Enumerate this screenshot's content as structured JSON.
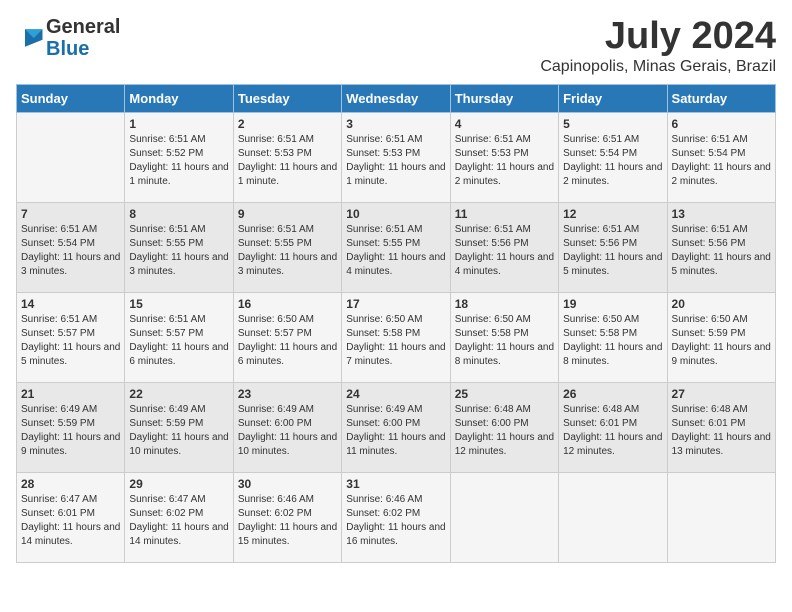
{
  "logo": {
    "line1": "General",
    "line2": "Blue"
  },
  "title": "July 2024",
  "location": "Capinopolis, Minas Gerais, Brazil",
  "days_header": [
    "Sunday",
    "Monday",
    "Tuesday",
    "Wednesday",
    "Thursday",
    "Friday",
    "Saturday"
  ],
  "weeks": [
    [
      {
        "day": "",
        "sunrise": "",
        "sunset": "",
        "daylight": ""
      },
      {
        "day": "1",
        "sunrise": "Sunrise: 6:51 AM",
        "sunset": "Sunset: 5:52 PM",
        "daylight": "Daylight: 11 hours and 1 minute."
      },
      {
        "day": "2",
        "sunrise": "Sunrise: 6:51 AM",
        "sunset": "Sunset: 5:53 PM",
        "daylight": "Daylight: 11 hours and 1 minute."
      },
      {
        "day": "3",
        "sunrise": "Sunrise: 6:51 AM",
        "sunset": "Sunset: 5:53 PM",
        "daylight": "Daylight: 11 hours and 1 minute."
      },
      {
        "day": "4",
        "sunrise": "Sunrise: 6:51 AM",
        "sunset": "Sunset: 5:53 PM",
        "daylight": "Daylight: 11 hours and 2 minutes."
      },
      {
        "day": "5",
        "sunrise": "Sunrise: 6:51 AM",
        "sunset": "Sunset: 5:54 PM",
        "daylight": "Daylight: 11 hours and 2 minutes."
      },
      {
        "day": "6",
        "sunrise": "Sunrise: 6:51 AM",
        "sunset": "Sunset: 5:54 PM",
        "daylight": "Daylight: 11 hours and 2 minutes."
      }
    ],
    [
      {
        "day": "7",
        "sunrise": "Sunrise: 6:51 AM",
        "sunset": "Sunset: 5:54 PM",
        "daylight": "Daylight: 11 hours and 3 minutes."
      },
      {
        "day": "8",
        "sunrise": "Sunrise: 6:51 AM",
        "sunset": "Sunset: 5:55 PM",
        "daylight": "Daylight: 11 hours and 3 minutes."
      },
      {
        "day": "9",
        "sunrise": "Sunrise: 6:51 AM",
        "sunset": "Sunset: 5:55 PM",
        "daylight": "Daylight: 11 hours and 3 minutes."
      },
      {
        "day": "10",
        "sunrise": "Sunrise: 6:51 AM",
        "sunset": "Sunset: 5:55 PM",
        "daylight": "Daylight: 11 hours and 4 minutes."
      },
      {
        "day": "11",
        "sunrise": "Sunrise: 6:51 AM",
        "sunset": "Sunset: 5:56 PM",
        "daylight": "Daylight: 11 hours and 4 minutes."
      },
      {
        "day": "12",
        "sunrise": "Sunrise: 6:51 AM",
        "sunset": "Sunset: 5:56 PM",
        "daylight": "Daylight: 11 hours and 5 minutes."
      },
      {
        "day": "13",
        "sunrise": "Sunrise: 6:51 AM",
        "sunset": "Sunset: 5:56 PM",
        "daylight": "Daylight: 11 hours and 5 minutes."
      }
    ],
    [
      {
        "day": "14",
        "sunrise": "Sunrise: 6:51 AM",
        "sunset": "Sunset: 5:57 PM",
        "daylight": "Daylight: 11 hours and 5 minutes."
      },
      {
        "day": "15",
        "sunrise": "Sunrise: 6:51 AM",
        "sunset": "Sunset: 5:57 PM",
        "daylight": "Daylight: 11 hours and 6 minutes."
      },
      {
        "day": "16",
        "sunrise": "Sunrise: 6:50 AM",
        "sunset": "Sunset: 5:57 PM",
        "daylight": "Daylight: 11 hours and 6 minutes."
      },
      {
        "day": "17",
        "sunrise": "Sunrise: 6:50 AM",
        "sunset": "Sunset: 5:58 PM",
        "daylight": "Daylight: 11 hours and 7 minutes."
      },
      {
        "day": "18",
        "sunrise": "Sunrise: 6:50 AM",
        "sunset": "Sunset: 5:58 PM",
        "daylight": "Daylight: 11 hours and 8 minutes."
      },
      {
        "day": "19",
        "sunrise": "Sunrise: 6:50 AM",
        "sunset": "Sunset: 5:58 PM",
        "daylight": "Daylight: 11 hours and 8 minutes."
      },
      {
        "day": "20",
        "sunrise": "Sunrise: 6:50 AM",
        "sunset": "Sunset: 5:59 PM",
        "daylight": "Daylight: 11 hours and 9 minutes."
      }
    ],
    [
      {
        "day": "21",
        "sunrise": "Sunrise: 6:49 AM",
        "sunset": "Sunset: 5:59 PM",
        "daylight": "Daylight: 11 hours and 9 minutes."
      },
      {
        "day": "22",
        "sunrise": "Sunrise: 6:49 AM",
        "sunset": "Sunset: 5:59 PM",
        "daylight": "Daylight: 11 hours and 10 minutes."
      },
      {
        "day": "23",
        "sunrise": "Sunrise: 6:49 AM",
        "sunset": "Sunset: 6:00 PM",
        "daylight": "Daylight: 11 hours and 10 minutes."
      },
      {
        "day": "24",
        "sunrise": "Sunrise: 6:49 AM",
        "sunset": "Sunset: 6:00 PM",
        "daylight": "Daylight: 11 hours and 11 minutes."
      },
      {
        "day": "25",
        "sunrise": "Sunrise: 6:48 AM",
        "sunset": "Sunset: 6:00 PM",
        "daylight": "Daylight: 11 hours and 12 minutes."
      },
      {
        "day": "26",
        "sunrise": "Sunrise: 6:48 AM",
        "sunset": "Sunset: 6:01 PM",
        "daylight": "Daylight: 11 hours and 12 minutes."
      },
      {
        "day": "27",
        "sunrise": "Sunrise: 6:48 AM",
        "sunset": "Sunset: 6:01 PM",
        "daylight": "Daylight: 11 hours and 13 minutes."
      }
    ],
    [
      {
        "day": "28",
        "sunrise": "Sunrise: 6:47 AM",
        "sunset": "Sunset: 6:01 PM",
        "daylight": "Daylight: 11 hours and 14 minutes."
      },
      {
        "day": "29",
        "sunrise": "Sunrise: 6:47 AM",
        "sunset": "Sunset: 6:02 PM",
        "daylight": "Daylight: 11 hours and 14 minutes."
      },
      {
        "day": "30",
        "sunrise": "Sunrise: 6:46 AM",
        "sunset": "Sunset: 6:02 PM",
        "daylight": "Daylight: 11 hours and 15 minutes."
      },
      {
        "day": "31",
        "sunrise": "Sunrise: 6:46 AM",
        "sunset": "Sunset: 6:02 PM",
        "daylight": "Daylight: 11 hours and 16 minutes."
      },
      {
        "day": "",
        "sunrise": "",
        "sunset": "",
        "daylight": ""
      },
      {
        "day": "",
        "sunrise": "",
        "sunset": "",
        "daylight": ""
      },
      {
        "day": "",
        "sunrise": "",
        "sunset": "",
        "daylight": ""
      }
    ]
  ]
}
